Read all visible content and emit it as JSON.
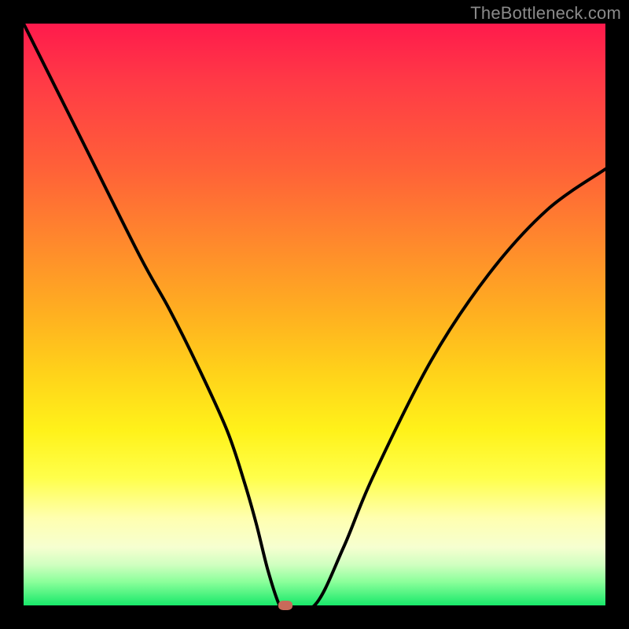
{
  "watermark": "TheBottleneck.com",
  "chart_data": {
    "type": "line",
    "title": "",
    "xlabel": "",
    "ylabel": "",
    "xlim": [
      0,
      100
    ],
    "ylim": [
      0,
      100
    ],
    "grid": false,
    "series": [
      {
        "name": "curve",
        "x": [
          0,
          10,
          20,
          25,
          30,
          35,
          38,
          40,
          42,
          44,
          45,
          50,
          55,
          60,
          70,
          80,
          90,
          100
        ],
        "values": [
          100,
          80,
          60,
          51,
          41,
          30,
          21,
          14,
          6,
          0,
          0,
          0,
          10,
          22,
          42,
          57,
          68,
          75
        ]
      }
    ],
    "marker": {
      "x": 45,
      "y": 0,
      "color": "#c96a5a"
    },
    "background_gradient": {
      "orientation": "vertical",
      "stops": [
        {
          "pos": 0.0,
          "color": "#ff1a4c"
        },
        {
          "pos": 0.5,
          "color": "#ffb020"
        },
        {
          "pos": 0.78,
          "color": "#ffff4a"
        },
        {
          "pos": 1.0,
          "color": "#18e86a"
        }
      ]
    }
  }
}
